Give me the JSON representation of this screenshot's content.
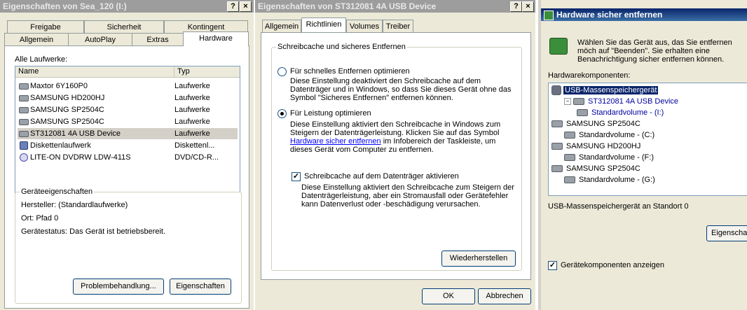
{
  "dialog1": {
    "title": "Eigenschaften von Sea_120 (I:)",
    "help_btn": "?",
    "close_btn": "×",
    "tabs_row1": [
      "Freigabe",
      "Sicherheit",
      "Kontingent"
    ],
    "tabs_row2": [
      "Allgemein",
      "AutoPlay",
      "Extras",
      "Hardware"
    ],
    "drives_label": "Alle Laufwerke:",
    "columns": [
      "Name",
      "Typ"
    ],
    "drives": [
      {
        "name": "Maxtor 6Y160P0",
        "type": "Laufwerke",
        "icon": "hard-drive-icon"
      },
      {
        "name": "SAMSUNG HD200HJ",
        "type": "Laufwerke",
        "icon": "hard-drive-icon"
      },
      {
        "name": "SAMSUNG SP2504C",
        "type": "Laufwerke",
        "icon": "hard-drive-icon"
      },
      {
        "name": "SAMSUNG SP2504C",
        "type": "Laufwerke",
        "icon": "hard-drive-icon"
      },
      {
        "name": "ST312081 4A USB Device",
        "type": "Laufwerke",
        "icon": "hard-drive-icon"
      },
      {
        "name": "Diskettenlaufwerk",
        "type": "Diskettenl...",
        "icon": "floppy-icon"
      },
      {
        "name": "LITE-ON DVDRW LDW-411S",
        "type": "DVD/CD-R...",
        "icon": "dvd-icon"
      }
    ],
    "props_group": "Geräteeigenschaften",
    "manufacturer": "Hersteller: (Standardlaufwerke)",
    "location": "Ort: Pfad 0",
    "status": "Gerätestatus: Das Gerät ist betriebsbereit.",
    "troubleshoot_btn": "Problembehandlung...",
    "properties_btn": "Eigenschaften"
  },
  "dialog2": {
    "title": "Eigenschaften von ST312081 4A USB Device",
    "help_btn": "?",
    "close_btn": "×",
    "tabs": [
      "Allgemein",
      "Richtlinien",
      "Volumes",
      "Treiber"
    ],
    "group": "Schreibcache und sicheres Entfernen",
    "opt1_label": "Für schnelles Entfernen optimieren",
    "opt1_desc": "Diese Einstellung deaktiviert den Schreibcache auf dem Datenträger und in Windows, so dass Sie dieses Gerät ohne das Symbol \"Sicheres Entfernen\" entfernen können.",
    "opt2_label": "Für Leistung optimieren",
    "opt2_desc_pre": "Diese Einstellung aktiviert den Schreibcache in Windows zum Steigern der Datenträgerleistung. Klicken Sie auf das Symbol",
    "opt2_link": "Hardware sicher entfernen",
    "opt2_desc_post": "im Infobereich der Taskleiste, um dieses Gerät vom Computer zu entfernen.",
    "check_label": "Schreibcache auf dem Datenträger aktivieren",
    "check_desc": "Diese Einstellung aktiviert den Schreibcache zum Steigern der Datenträgerleistung, aber ein Stromausfall oder Gerätefehler kann Datenverlust oder -beschädigung verursachen.",
    "check_mark": "✓",
    "restore_btn": "Wiederherstellen",
    "ok_btn": "OK",
    "cancel_btn": "Abbrechen"
  },
  "dialog3": {
    "title": "Hardware sicher entfernen",
    "intro": "Wählen Sie das Gerät aus, das Sie entfernen möch auf \"Beenden\". Sie erhalten eine Benachrichtigung sicher entfernen können.",
    "components_label": "Hardwarekomponenten:",
    "tree": [
      {
        "label": "USB-Massenspeichergerät",
        "level": 0,
        "selected": true,
        "icon": "usb-device-icon"
      },
      {
        "label": "ST312081 4A USB Device",
        "level": 1,
        "link": true,
        "expander": "−",
        "icon": "hard-drive-icon"
      },
      {
        "label": "Standardvolume - (I:)",
        "level": 2,
        "link": true,
        "icon": "volume-icon"
      },
      {
        "label": "SAMSUNG SP2504C",
        "level": 0,
        "icon": "hard-drive-icon"
      },
      {
        "label": "Standardvolume - (C:)",
        "level": 1,
        "icon": "volume-icon"
      },
      {
        "label": "SAMSUNG HD200HJ",
        "level": 0,
        "icon": "hard-drive-icon"
      },
      {
        "label": "Standardvolume - (F:)",
        "level": 1,
        "icon": "volume-icon"
      },
      {
        "label": "SAMSUNG SP2504C",
        "level": 0,
        "icon": "hard-drive-icon"
      },
      {
        "label": "Standardvolume - (G:)",
        "level": 1,
        "icon": "volume-icon"
      }
    ],
    "location": "USB-Massenspeichergerät an Standort 0",
    "properties_btn": "Eigenscha",
    "show_components": "Gerätekomponenten anzeigen",
    "check_mark": "✓"
  }
}
